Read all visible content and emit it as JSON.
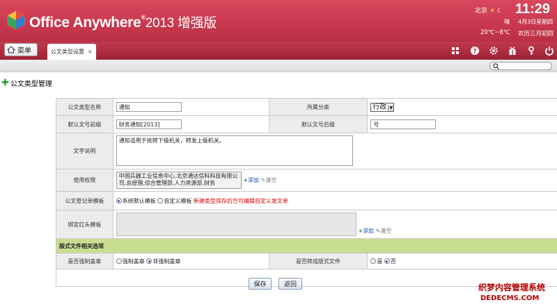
{
  "header": {
    "brand": "Office Anywhere",
    "brand_mark": "®",
    "brand_suffix": "2013 增强版",
    "city": "北京",
    "clock": "11:29",
    "weather": "晴",
    "date": "4月3日星期四",
    "temp": "20℃~8℃",
    "lunar_date": "农历三月初四"
  },
  "nav": {
    "menu_label": "菜单",
    "tab_label": "公文类型设置",
    "tab_close": "×",
    "icons": [
      "grid-icon",
      "help-icon",
      "settings-icon",
      "gift-icon",
      "key-icon",
      "power-icon"
    ]
  },
  "page": {
    "title": "公文类型管理"
  },
  "form": {
    "type_name_label": "公文类型名称",
    "type_name_value": "通知",
    "category_label": "所属分类",
    "category_value": "行政",
    "prefix_label": "默认文号前缀",
    "prefix_value": "财务通知[2013]",
    "suffix_label": "默认文号后缀",
    "suffix_value": "号",
    "desc_label": "文字说明",
    "desc_value": "通知适用于批转下级机关，转发上级机关。",
    "perm_label": "使用权限",
    "perm_value": "中国兵器工业信息中心,北京通达信科科技有限公司,总经理,综合管理部,人力资源部,财务",
    "perm_add": "添加",
    "perm_clear": "清空",
    "template_label": "公文登记单模板",
    "template_opt1": "系统默认模板",
    "template_opt2": "自定义模板",
    "template_note": "新建类型保存后方可编辑自定义发文单",
    "redhead_label": "绑定红头模板",
    "redhead_add": "添加",
    "redhead_clear": "清空",
    "section_title": "版式文件相关选项",
    "seal_label": "是否强制盖章",
    "seal_opt1": "强制盖章",
    "seal_opt2": "非强制盖章",
    "convert_label": "是否转成版式文件",
    "convert_yes": "是",
    "convert_no": "否"
  },
  "buttons": {
    "save": "保存",
    "back": "返回"
  },
  "watermark": {
    "line1": "织梦内容管理系统",
    "line2": "DEDECMS.COM"
  },
  "colors": {
    "header_red": "#c8384e",
    "section_green": "#c9dd91",
    "note_red": "#dd0000"
  }
}
